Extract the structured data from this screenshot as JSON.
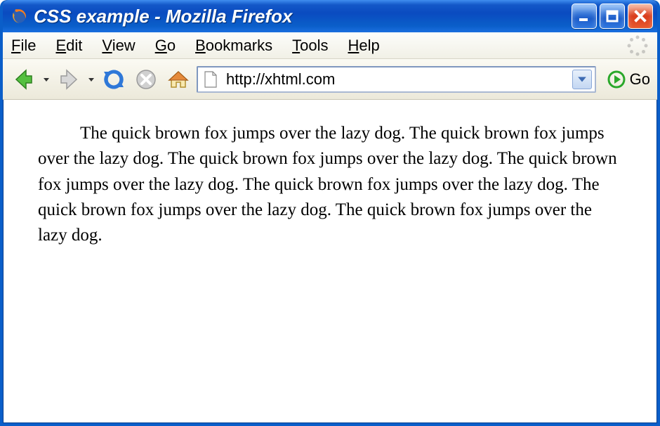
{
  "window": {
    "title": "CSS example - Mozilla Firefox"
  },
  "menu": {
    "items": [
      "File",
      "Edit",
      "View",
      "Go",
      "Bookmarks",
      "Tools",
      "Help"
    ]
  },
  "toolbar": {
    "go_label": "Go"
  },
  "url": {
    "value": "http://xhtml.com"
  },
  "page": {
    "body_text": "The quick brown fox jumps over the lazy dog. The quick brown fox jumps over the lazy dog. The quick brown fox jumps over the lazy dog. The quick brown fox jumps over the lazy dog. The quick brown fox jumps over the lazy dog. The quick brown fox jumps over the lazy dog. The quick brown fox jumps over the lazy dog."
  }
}
